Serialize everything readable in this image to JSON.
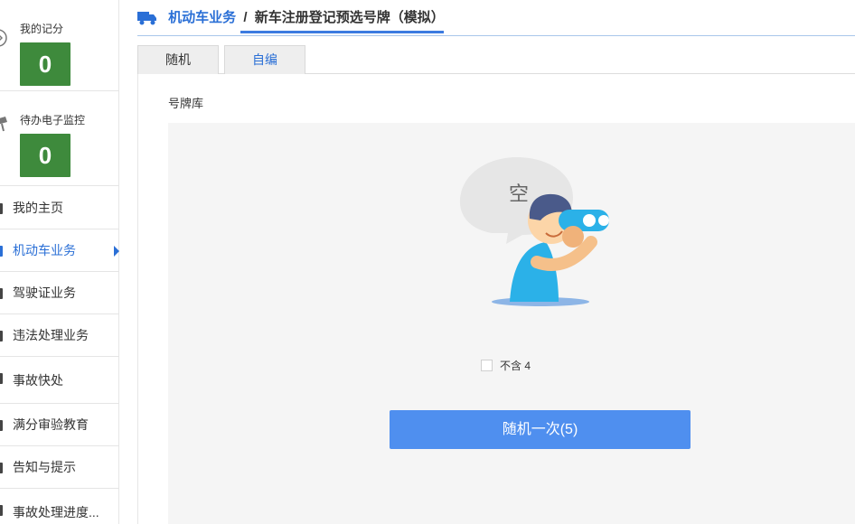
{
  "sidebar": {
    "scores": [
      {
        "label": "我的记分",
        "value": "0",
        "icon": "score-badge-icon"
      },
      {
        "label": "待办电子监控",
        "value": "0",
        "icon": "camera-icon"
      }
    ],
    "items": [
      {
        "label": "我的主页",
        "icon": "home-icon"
      },
      {
        "label": "机动车业务",
        "icon": "vehicle-icon",
        "active": true
      },
      {
        "label": "驾驶证业务",
        "icon": "license-icon"
      },
      {
        "label": "违法处理业务",
        "icon": "violation-icon"
      },
      {
        "label": "事故快处",
        "icon": "accident-icon"
      },
      {
        "label": "满分审验教育",
        "icon": "education-icon"
      },
      {
        "label": "告知与提示",
        "icon": "notice-icon"
      },
      {
        "label": "事故处理进度...",
        "icon": "progress-icon"
      }
    ]
  },
  "header": {
    "section": "机动车业务",
    "separator": "/",
    "page": "新车注册登记预选号牌（模拟）"
  },
  "tabs": [
    {
      "label": "随机",
      "active": true
    },
    {
      "label": "自编",
      "active": false
    }
  ],
  "main": {
    "library_label": "号牌库",
    "empty_bubble_text": "空",
    "exclude_four_label": "不含 4",
    "random_button_label": "随机一次(5)"
  },
  "colors": {
    "accent": "#2a6fd6",
    "button": "#4f8fef",
    "score_bg": "#3e8a3c"
  }
}
